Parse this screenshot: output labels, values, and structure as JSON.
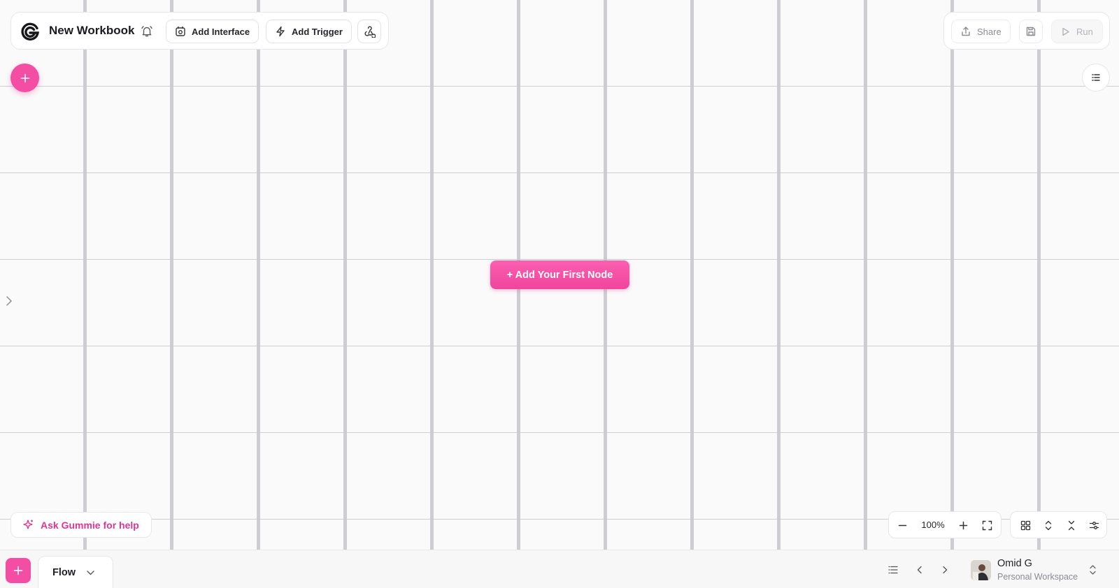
{
  "header": {
    "title": "New Workbook",
    "add_interface_label": "Add Interface",
    "add_trigger_label": "Add Trigger"
  },
  "actions": {
    "share_label": "Share",
    "run_label": "Run"
  },
  "canvas": {
    "add_first_node_label": "+ Add Your First Node"
  },
  "help": {
    "ask_label": "Ask Gummie for help"
  },
  "zoom": {
    "level": "100%"
  },
  "bottom_bar": {
    "tab_label": "Flow",
    "user_name": "Omid G",
    "workspace": "Personal Workspace"
  },
  "colors": {
    "accent": "#f0459c",
    "accent_light": "#fb5fb0"
  }
}
